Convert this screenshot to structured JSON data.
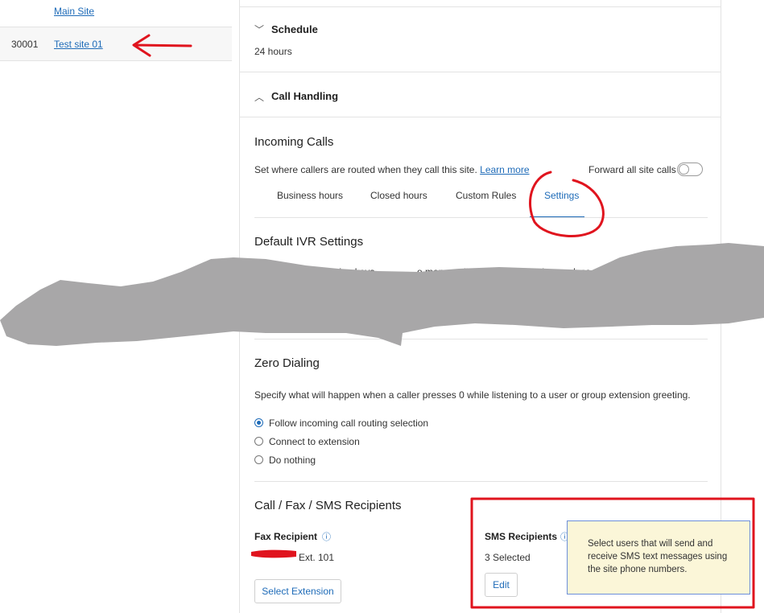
{
  "sites": [
    {
      "id": "",
      "name": "Main Site"
    },
    {
      "id": "30001",
      "name": "Test site 01"
    }
  ],
  "schedule": {
    "title": "Schedule",
    "value": "24 hours"
  },
  "call_handling": {
    "title": "Call Handling"
  },
  "incoming": {
    "title": "Incoming Calls",
    "desc": "Set where callers are routed when they call this site.",
    "learn_more": "Learn more",
    "forward_label": "Forward all site calls",
    "tabs": [
      "Business hours",
      "Closed hours",
      "Custom Rules",
      "Settings"
    ],
    "active_tab": "Settings"
  },
  "ivr": {
    "title": "Default IVR Settings",
    "partial_text_a": "ination keys.",
    "partial_text_b": "e menus will follow these settings unless you c"
  },
  "zero_dialing": {
    "title": "Zero Dialing",
    "desc": "Specify what will happen when a caller presses 0 while listening to a user or group extension greeting.",
    "options": [
      "Follow incoming call routing selection",
      "Connect to extension",
      "Do nothing"
    ],
    "selected_index": 0
  },
  "recipients": {
    "title": "Call / Fax / SMS Recipients",
    "fax_label": "Fax Recipient",
    "fax_value": "Ext. 101",
    "fax_button": "Select Extension",
    "sms_label": "SMS Recipients",
    "sms_value": "3 Selected",
    "sms_button": "Edit",
    "tooltip": "Select users that will send and receive SMS text messages using the site phone numbers."
  },
  "icons": {
    "info": "ⓘ",
    "chevron_down": "﹀",
    "chevron_up": "︿"
  },
  "colors": {
    "link": "#1e6bb8",
    "annotation": "#e0141e",
    "redaction": "#a8a7a8",
    "tooltip_bg": "#fbf6d8"
  }
}
